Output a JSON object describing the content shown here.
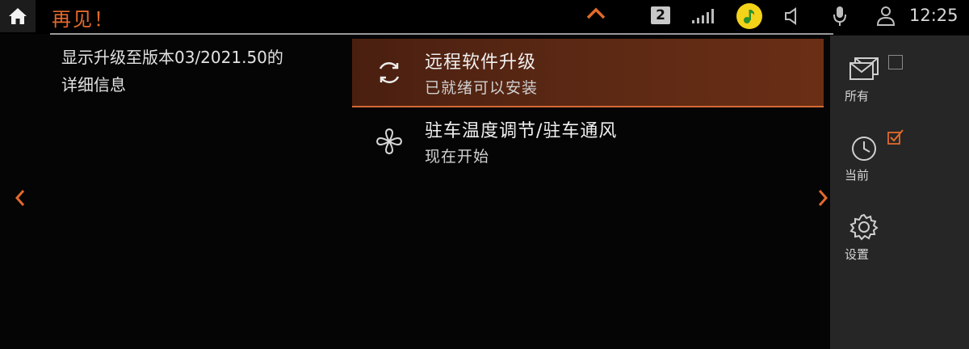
{
  "topbar": {
    "title": "再见！",
    "sat_badge": "2",
    "clock": "12:25"
  },
  "info": {
    "line1": "显示升级至版本03/2021.50的",
    "line2": "详细信息"
  },
  "list": {
    "items": [
      {
        "title": "远程软件升级",
        "subtitle": "已就绪可以安装",
        "icon": "refresh-icon",
        "selected": true
      },
      {
        "title": "驻车温度调节/驻车通风",
        "subtitle": "现在开始",
        "icon": "fan-icon",
        "selected": false
      }
    ]
  },
  "sidebar": {
    "items": [
      {
        "label": "所有",
        "icon": "mail-icon",
        "checked": false
      },
      {
        "label": "当前",
        "icon": "clock-icon",
        "checked": true
      },
      {
        "label": "设置",
        "icon": "gear-icon",
        "checked": false
      }
    ]
  },
  "colors": {
    "accent": "#e26a2c",
    "selected_bg": "#5a2814",
    "sidebar_bg": "#262626"
  }
}
